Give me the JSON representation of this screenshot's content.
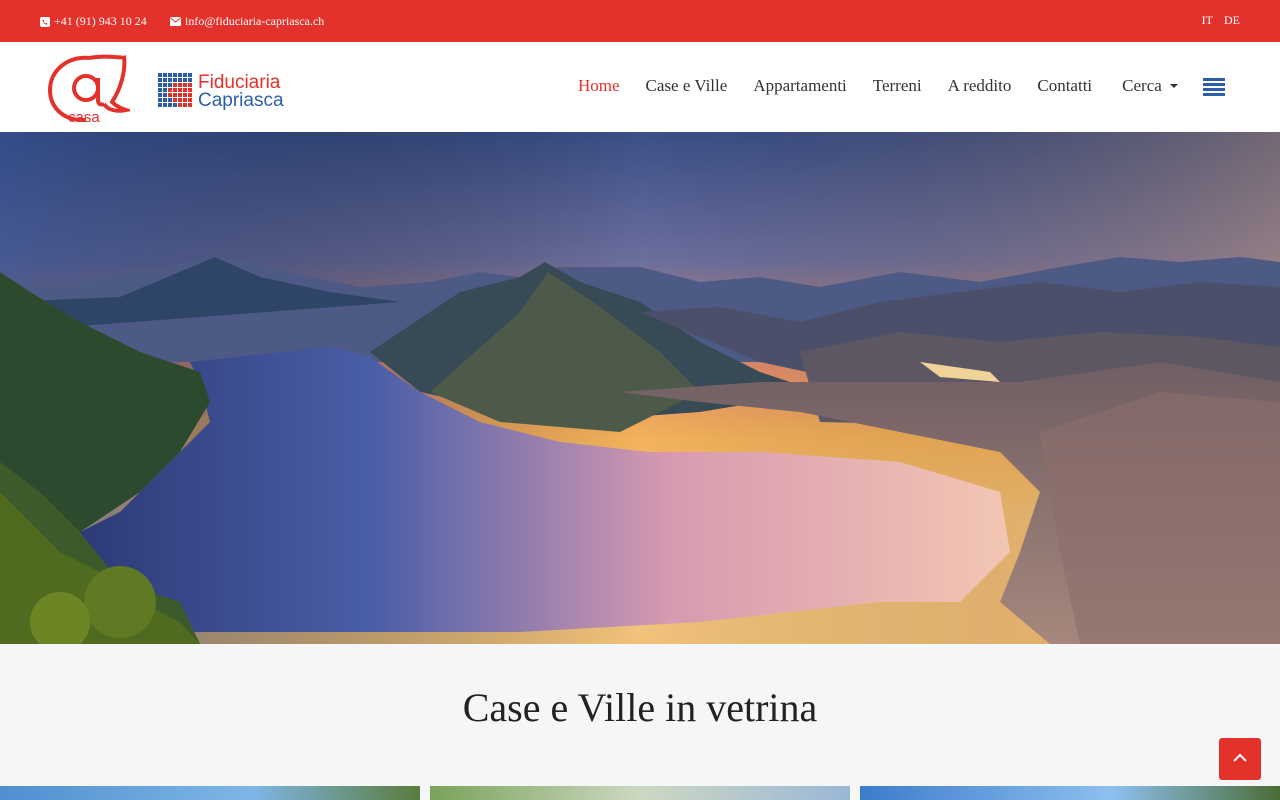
{
  "topbar": {
    "phone": "+41 (91) 943 10 24",
    "email": "info@fiduciaria-capriasca.ch",
    "languages": [
      "IT",
      "DE"
    ]
  },
  "brand": {
    "logo_at_text": "casa",
    "name_line1": "Fiduciaria",
    "name_line2": "Capriasca"
  },
  "nav": {
    "items": [
      "Home",
      "Case e Ville",
      "Appartamenti",
      "Terreni",
      "A reddito",
      "Contatti"
    ],
    "active": "Home",
    "dropdown_label": "Cerca"
  },
  "section": {
    "title": "Case e Ville in vetrina"
  },
  "colors": {
    "brand_red": "#e3312c",
    "brand_blue": "#2c5ea8"
  },
  "icons": {
    "phone": "phone-icon",
    "email": "envelope-icon",
    "menu": "menu-lines-icon",
    "scroll_top": "chevron-up-icon"
  }
}
